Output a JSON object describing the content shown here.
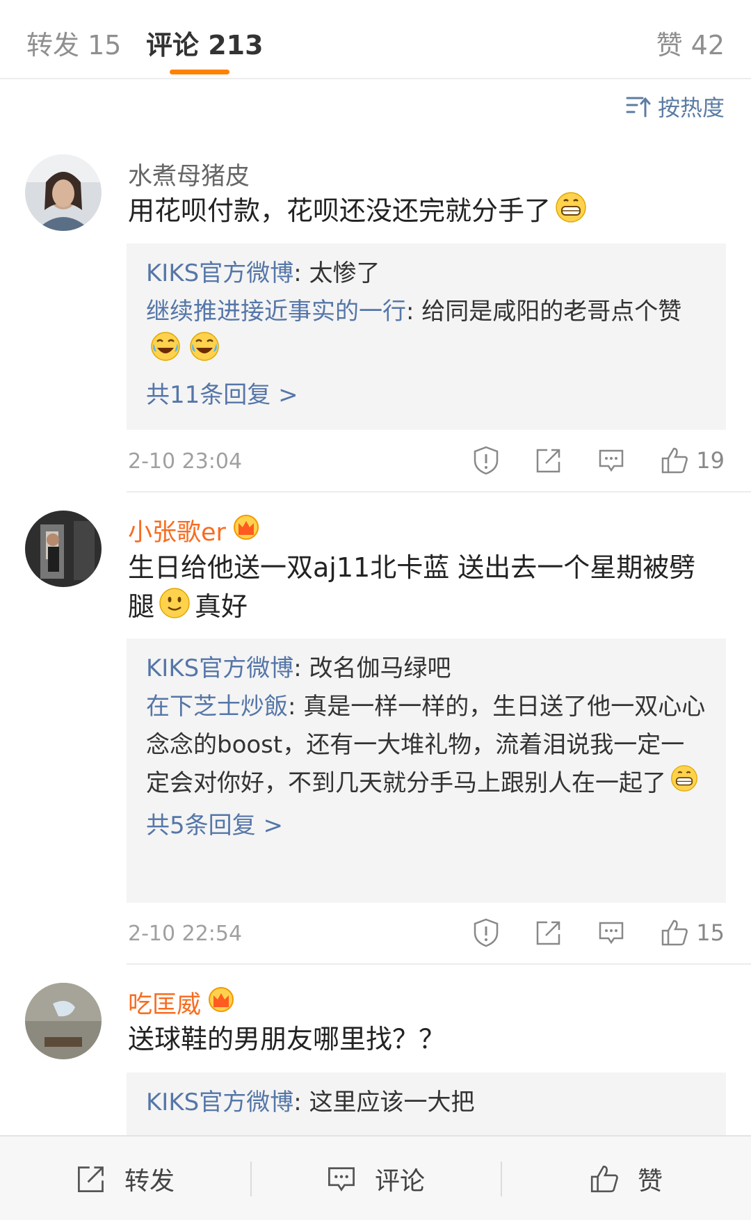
{
  "tabs": [
    {
      "label": "转发 15"
    },
    {
      "label": "评论 213"
    },
    {
      "label": "赞 42"
    }
  ],
  "sort": {
    "label": "按热度"
  },
  "comments": [
    {
      "user": "水煮母猪皮",
      "text": "用花呗付款，花呗还没还完就分手了",
      "replies": [
        {
          "who": "KIKS官方微博",
          "text": ": 太惨了"
        },
        {
          "who": "继续推进接近事实的一行",
          "text": ": 给同是咸阳的老哥点个赞"
        }
      ],
      "more": "共11条回复 >",
      "time": "2-10 23:04",
      "likes": "19"
    },
    {
      "user": "小张歌er",
      "text_a": "生日给他送一双aj11北卡蓝 送出去一个星期被劈腿",
      "text_b": "真好",
      "replies": [
        {
          "who": "KIKS官方微博",
          "text": ": 改名伽马绿吧"
        },
        {
          "who": "在下芝士炒飯",
          "text": ": 真是一样一样的，生日送了他一双心心念念的boost，还有一大堆礼物，流着泪说我一定一定会对你好，不到几天就分手马上跟别人在一起了"
        }
      ],
      "more": "共5条回复 >",
      "time": "2-10 22:54",
      "likes": "15"
    },
    {
      "user": "吃匡威",
      "text": "送球鞋的男朋友哪里找？？",
      "replies": [
        {
          "who": "KIKS官方微博",
          "text": ": 这里应该一大把"
        }
      ]
    }
  ],
  "bottom_bar": [
    {
      "label": "转发",
      "icon": "share-icon"
    },
    {
      "label": "评论",
      "icon": "comment-icon"
    },
    {
      "label": "赞",
      "icon": "thumbs-up-icon"
    }
  ],
  "colors": {
    "accent": "#ff8200",
    "link": "#5576a8",
    "vip_name": "#f86c1f"
  }
}
